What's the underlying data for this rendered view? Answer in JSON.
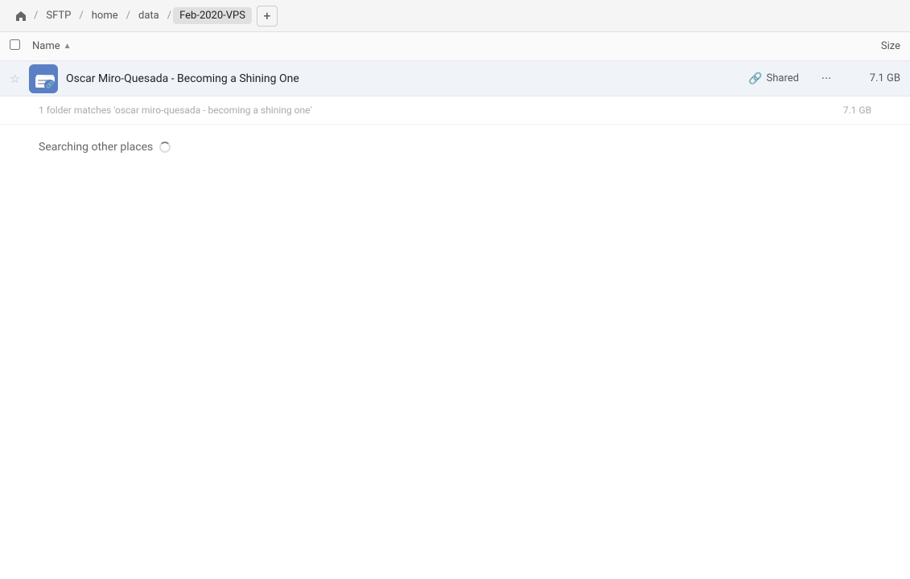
{
  "topbar": {
    "home_icon": "⌂",
    "breadcrumbs": [
      {
        "label": "SFTP",
        "active": false
      },
      {
        "label": "home",
        "active": false
      },
      {
        "label": "data",
        "active": false
      },
      {
        "label": "Feb-2020-VPS",
        "active": true
      }
    ],
    "add_tab_icon": "+"
  },
  "columns": {
    "name_label": "Name",
    "sort_icon": "▲",
    "size_label": "Size"
  },
  "file_result": {
    "star_icon": "☆",
    "name": "Oscar Miro-Quesada - Becoming a Shining One",
    "shared_icon": "🔗",
    "shared_label": "Shared",
    "more_icon": "•••",
    "size": "7.1 GB"
  },
  "search_info": {
    "text": "1 folder matches 'oscar miro-quesada - becoming a shining one'",
    "size": "7.1 GB"
  },
  "searching": {
    "label": "Searching other places"
  }
}
